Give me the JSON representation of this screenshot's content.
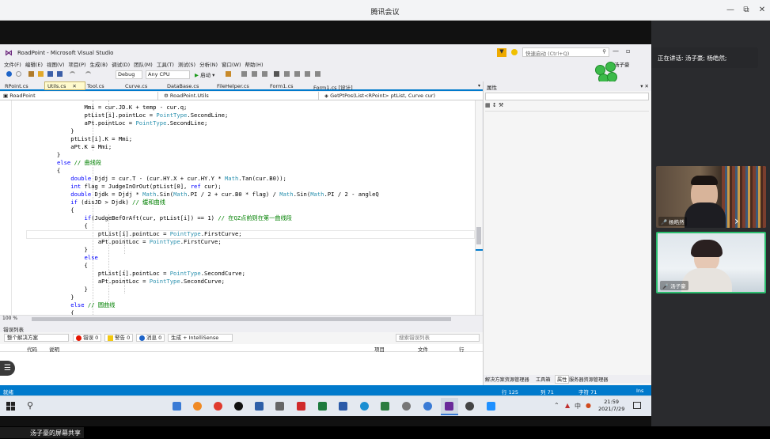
{
  "meeting": {
    "app_title": "腾讯会议",
    "speaking": "正在讲话: 汤子豪; 杨皓然;",
    "participants": [
      {
        "name": "杨皓然"
      },
      {
        "name": "汤子豪"
      }
    ],
    "share_label": "汤子豪的屏幕共享",
    "window_controls": [
      "—",
      "⧉",
      "✕"
    ]
  },
  "vs": {
    "title": "RoadPoint - Microsoft Visual Studio",
    "quick_launch_placeholder": "快速启动 (Ctrl+Q)",
    "user": "汤子豪",
    "menu": [
      "文件(F)",
      "编辑(E)",
      "视图(V)",
      "项目(P)",
      "生成(B)",
      "调试(D)",
      "团队(M)",
      "工具(T)",
      "测试(S)",
      "分析(N)",
      "窗口(W)",
      "帮助(H)"
    ],
    "toolbar": {
      "config": "Debug",
      "platform": "Any CPU",
      "start": "启动"
    },
    "tabs": [
      {
        "label": "RPoint.cs"
      },
      {
        "label": "Utils.cs",
        "active": true
      },
      {
        "label": "Tool.cs"
      },
      {
        "label": "Curve.cs"
      },
      {
        "label": "DataBase.cs"
      },
      {
        "label": "FileHelper.cs"
      },
      {
        "label": "Form1.cs"
      },
      {
        "label": "Form1.cs [设计]"
      }
    ],
    "nav": {
      "project": "RoadPoint",
      "class": "RoadPoint.Utils",
      "member": "GetPtPos(List<RPoint> ptList, Curve cur)"
    },
    "code_lines": [
      "                    Mmi = cur.JD.K + temp - cur.q;",
      "                    ptList[i].pointLoc = PointType.SecondLine;",
      "                    aPt.pointLoc = PointType.SecondLine;",
      "                }",
      "                ptList[i].K = Mmi;",
      "                aPt.K = Mmi;",
      "            }",
      "            else // 曲线段",
      "            {",
      "                double Djdj = cur.T - (cur.HY.X + cur.HY.Y * Math.Tan(cur.B0));",
      "                int flag = JudgeInOrOut(ptList[0], ref cur);",
      "                double Djdk = Djdj * Math.Sin(Math.PI / 2 + cur.B0 * flag) / Math.Sin(Math.PI / 2 - angleQ",
      "                if (disJD > Djdk) // 缓和曲线",
      "                {",
      "                    if(JudgeBefOrAft(cur, ptList[i]) == 1) // 在QZ点前则在第一曲线段",
      "                    {",
      "                        ptList[i].pointLoc = PointType.FirstCurve;",
      "                        aPt.pointLoc = PointType.FirstCurve;",
      "                    }",
      "                    else",
      "                    {",
      "                        ptList[i].pointLoc = PointType.SecondCurve;",
      "                        aPt.pointLoc = PointType.SecondCurve;",
      "                    }",
      "                }",
      "                else // 圆曲线",
      "                {"
    ],
    "zoom": "100 %",
    "error_list": {
      "title": "错误列表",
      "scope": "整个解决方案",
      "errors": "错误 0",
      "warnings": "警告 0",
      "messages": "消息 0",
      "build_filter": "生成 + IntelliSense",
      "search_placeholder": "搜索错误列表",
      "columns": [
        "代码",
        "说明",
        "项目",
        "文件",
        "行"
      ]
    },
    "properties": {
      "title": "属性",
      "tabs": [
        "解决方案资源管理器",
        "工具箱",
        "属性",
        "服务器资源管理器"
      ]
    },
    "status": {
      "ready": "就绪",
      "line": "行 125",
      "col": "列 71",
      "char": "字符 71",
      "ins": "Ins"
    }
  },
  "taskbar": {
    "time": "21:59",
    "date": "2021/7/29",
    "ime": "中"
  },
  "colors": {
    "vs_accent": "#007acc",
    "active_speaker": "#2bbd6e",
    "keyword": "#0000ff",
    "type": "#2b91af",
    "comment": "#008000"
  }
}
